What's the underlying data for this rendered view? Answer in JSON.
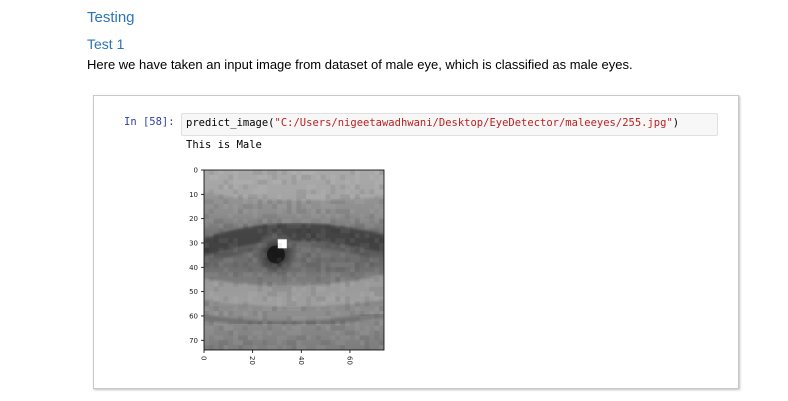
{
  "document": {
    "heading": "Testing",
    "subheading": "Test 1",
    "paragraph": "Here we have taken an input image from dataset of male eye, which is classified as male eyes."
  },
  "notebook": {
    "prompt": "In [58]:",
    "code_func": "predict_image(",
    "code_arg": "\"C:/Users/nigeetawadhwani/Desktop/EyeDetector/maleeyes/255.jpg\"",
    "code_close": ")",
    "output_text": "This is Male"
  },
  "chart_data": {
    "type": "heatmap",
    "title": "",
    "xlabel": "",
    "ylabel": "",
    "x_ticks": [
      "0",
      "20",
      "40",
      "60"
    ],
    "y_ticks": [
      "0",
      "10",
      "20",
      "30",
      "40",
      "50",
      "60",
      "70"
    ],
    "xlim": [
      0,
      74
    ],
    "ylim": [
      74,
      0
    ],
    "colormap": "gray",
    "colors": {
      "pupil": "#1a1a1a",
      "highlight": "#ffffff",
      "skin_light": "#a8a8a8",
      "skin_dark": "#585858"
    }
  }
}
